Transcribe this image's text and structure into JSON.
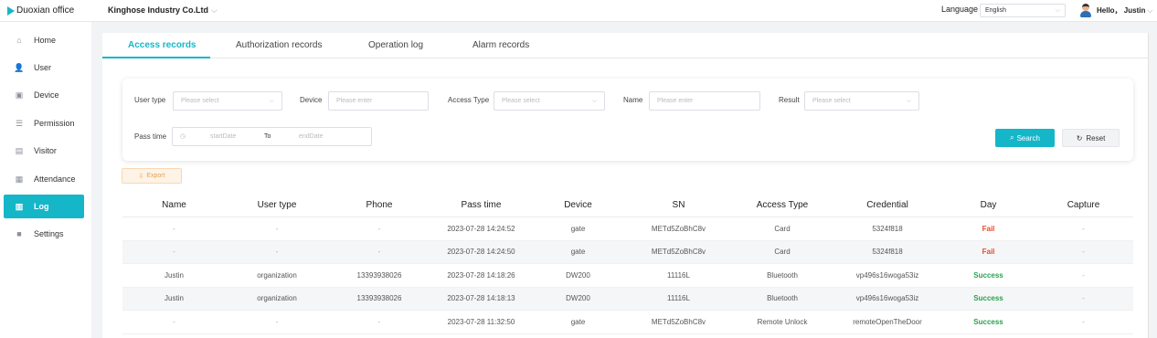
{
  "app": {
    "logo_text": "Duoxian office",
    "company": "Kinghose Industry Co.Ltd"
  },
  "header": {
    "language_label": "Language",
    "language_value": "English",
    "greeting": "Hello， Justin"
  },
  "sidebar": {
    "items": [
      {
        "label": "Home",
        "icon": "home-icon"
      },
      {
        "label": "User",
        "icon": "user-icon"
      },
      {
        "label": "Device",
        "icon": "device-icon"
      },
      {
        "label": "Permission",
        "icon": "permission-icon"
      },
      {
        "label": "Visitor",
        "icon": "visitor-icon"
      },
      {
        "label": "Attendance",
        "icon": "attendance-icon"
      },
      {
        "label": "Log",
        "icon": "log-icon",
        "active": true
      },
      {
        "label": "Settings",
        "icon": "settings-icon"
      }
    ]
  },
  "tabs": [
    {
      "label": "Access records",
      "active": true
    },
    {
      "label": "Authorization records"
    },
    {
      "label": "Operation log"
    },
    {
      "label": "Alarm records"
    }
  ],
  "filters": {
    "user_type_label": "User type",
    "user_type_placeholder": "Please select",
    "device_label": "Device",
    "device_placeholder": "Please enter",
    "access_type_label": "Access Type",
    "access_type_placeholder": "Please select",
    "name_label": "Name",
    "name_placeholder": "Please enter",
    "result_label": "Result",
    "result_placeholder": "Please select",
    "pass_time_label": "Pass time",
    "start_placeholder": "startDate",
    "to_label": "To",
    "end_placeholder": "endDate",
    "search_label": "Search",
    "reset_label": "Reset"
  },
  "export_label": "Export",
  "table": {
    "columns": [
      "Name",
      "User type",
      "Phone",
      "Pass time",
      "Device",
      "SN",
      "Access Type",
      "Credential",
      "Day",
      "Capture"
    ],
    "rows": [
      [
        "-",
        "-",
        "-",
        "2023-07-28 14:24:52",
        "gate",
        "METd5ZoBhC8v",
        "Card",
        "5324f818",
        "Fail",
        "-"
      ],
      [
        "-",
        "-",
        "-",
        "2023-07-28 14:24:50",
        "gate",
        "METd5ZoBhC8v",
        "Card",
        "5324f818",
        "Fail",
        "-"
      ],
      [
        "Justin",
        "organization",
        "13393938026",
        "2023-07-28 14:18:26",
        "DW200",
        "11116L",
        "Bluetooth",
        "vp496s16woga53iz",
        "Success",
        "-"
      ],
      [
        "Justin",
        "organization",
        "13393938026",
        "2023-07-28 14:18:13",
        "DW200",
        "11116L",
        "Bluetooth",
        "vp496s16woga53iz",
        "Success",
        "-"
      ],
      [
        "-",
        "-",
        "-",
        "2023-07-28 11:32:50",
        "gate",
        "METd5ZoBhC8v",
        "Remote Unlock",
        "remoteOpenTheDoor",
        "Success",
        "-"
      ]
    ]
  },
  "colors": {
    "accent": "#16b6c9",
    "fail": "#e84a2c",
    "success": "#2aa14e"
  }
}
